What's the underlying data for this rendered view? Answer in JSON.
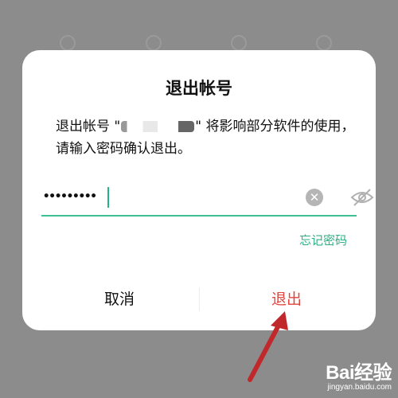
{
  "dialog": {
    "title": "退出帐号",
    "message_prefix": "退出帐号 \"",
    "message_suffix": "\" 将影响部分软件的使用，请输入密码确认退出。",
    "password_masked": "•••••••••",
    "forgot_link": "忘记密码",
    "cancel_label": "取消",
    "confirm_label": "退出"
  },
  "watermark": {
    "logo": "Bai经验",
    "url": "jingyan.baidu.com"
  },
  "colors": {
    "accent": "#2fae85",
    "danger": "#e0463f",
    "arrow": "#c0282b"
  }
}
